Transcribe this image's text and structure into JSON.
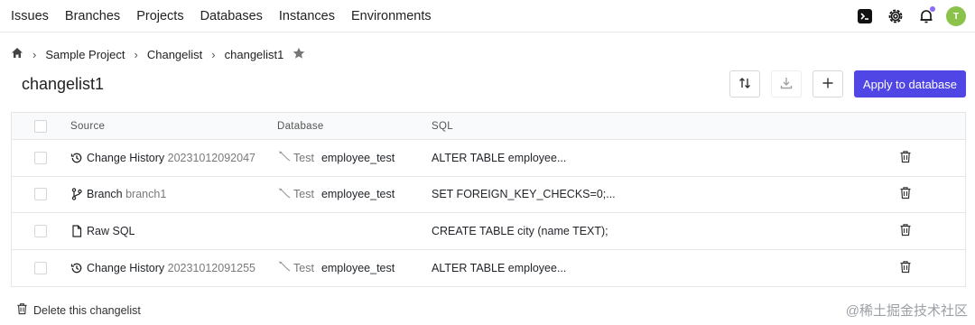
{
  "nav": {
    "items": [
      "Issues",
      "Branches",
      "Projects",
      "Databases",
      "Instances",
      "Environments"
    ],
    "avatar_initial": "T",
    "icons": [
      "terminal-icon",
      "gear-icon",
      "bell-icon"
    ]
  },
  "breadcrumb": {
    "items": [
      "Sample Project",
      "Changelist",
      "changelist1"
    ]
  },
  "page": {
    "title": "changelist1",
    "apply_button": "Apply to database"
  },
  "table": {
    "headers": {
      "source": "Source",
      "database": "Database",
      "sql": "SQL"
    },
    "rows": [
      {
        "source_type": "Change History",
        "source_ref": "20231012092047",
        "source_icon": "history-icon",
        "env": "Test",
        "database": "employee_test",
        "sql": "ALTER TABLE employee..."
      },
      {
        "source_type": "Branch",
        "source_ref": "branch1",
        "source_icon": "branch-icon",
        "env": "Test",
        "database": "employee_test",
        "sql": "SET FOREIGN_KEY_CHECKS=0;..."
      },
      {
        "source_type": "Raw SQL",
        "source_ref": "",
        "source_icon": "file-icon",
        "env": "",
        "database": "",
        "sql": "CREATE TABLE city (name TEXT);"
      },
      {
        "source_type": "Change History",
        "source_ref": "20231012091255",
        "source_icon": "history-icon",
        "env": "Test",
        "database": "employee_test",
        "sql": "ALTER TABLE employee..."
      }
    ]
  },
  "footer": {
    "delete_label": "Delete this changelist",
    "watermark": "@稀土掘金技术社区"
  },
  "colors": {
    "primary": "#4f46e5",
    "avatar": "#8bc34a",
    "notify_dot": "#8b6cf6"
  }
}
